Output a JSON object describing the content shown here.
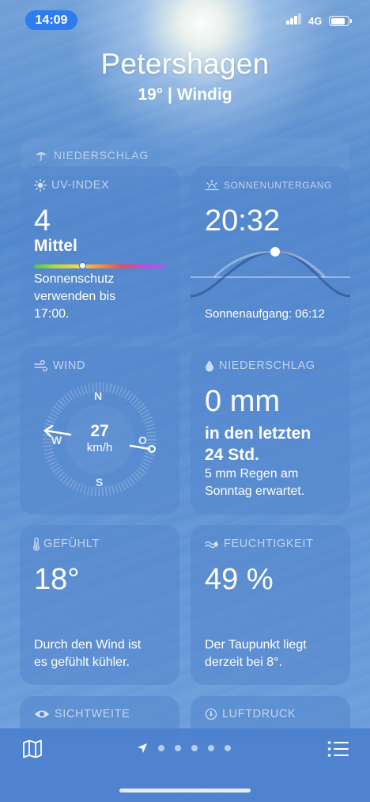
{
  "status": {
    "time": "14:09",
    "network": "4G"
  },
  "header": {
    "city": "Petershagen",
    "summary": "19°  |  Windig"
  },
  "collapsed_section": {
    "label": "NIEDERSCHLAG"
  },
  "uv": {
    "label": "UV-INDEX",
    "value": "4",
    "level": "Mittel",
    "advice": [
      "Sonnenschutz",
      "verwenden bis",
      "17:00."
    ],
    "scale_position": 0.37
  },
  "sunset": {
    "label": "SONNENUNTERGANG",
    "time": "20:32",
    "sunrise": "Sonnenaufgang: 06:12"
  },
  "wind": {
    "label": "WIND",
    "speed": "27",
    "unit": "km/h",
    "compass": {
      "n": "N",
      "s": "S",
      "w": "W",
      "o": "O"
    }
  },
  "precipitation": {
    "label": "NIEDERSCHLAG",
    "amount": "0 mm",
    "period_line1": "in den letzten",
    "period_line2": "24 Std.",
    "forecast": [
      "5 mm Regen am",
      "Sonntag erwartet."
    ]
  },
  "feels_like": {
    "label": "GEFÜHLT",
    "value": "18°",
    "note": [
      "Durch den Wind ist",
      "es gefühlt kühler."
    ]
  },
  "humidity": {
    "label": "FEUCHTIGKEIT",
    "value": "49 %",
    "note": [
      "Der Taupunkt liegt",
      "derzeit bei 8°."
    ]
  },
  "visibility": {
    "label": "SICHTWEITE"
  },
  "pressure": {
    "label": "LUFTDRUCK"
  },
  "toolbar": {
    "map_icon": "map-icon",
    "list_icon": "list-icon",
    "page_count": 5,
    "current_page": "location"
  },
  "colors": {
    "time_pill": "#2f7cf0",
    "tile": "#5587cd",
    "bottom_bar": "#4e82cd"
  }
}
